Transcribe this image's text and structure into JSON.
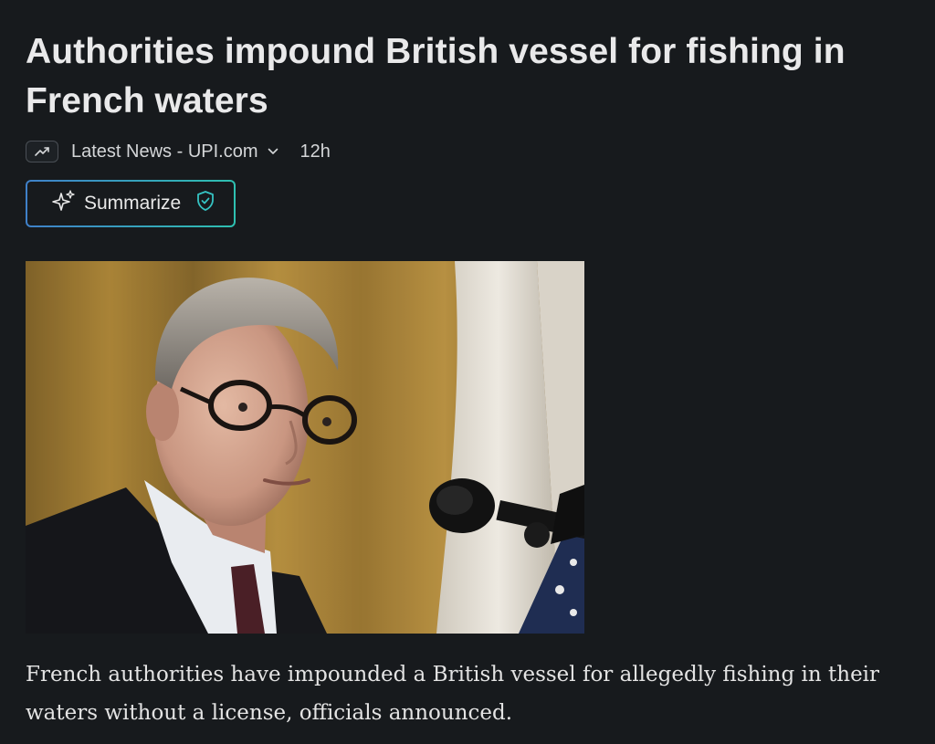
{
  "article": {
    "headline": "Authorities impound British vessel for fishing in French waters",
    "source": {
      "icon": "trending-up-icon",
      "name": "Latest News - UPI.com",
      "menu_icon": "chevron-down-icon"
    },
    "age": "12h",
    "summarize_button": {
      "label": "Summarize",
      "icon": "sparkles-icon",
      "badge_icon": "shield-check-icon"
    },
    "image": {
      "kind": "news-photo"
    },
    "summary": "French authorities have impounded a British vessel for allegedly fishing in their waters without a license, officials announced."
  },
  "colors": {
    "background": "#171a1d",
    "text": "#e9e9ea",
    "button_gradient_start": "#3f80c9",
    "button_gradient_end": "#2ec0b0",
    "shield_icon": "#35c3c3"
  }
}
